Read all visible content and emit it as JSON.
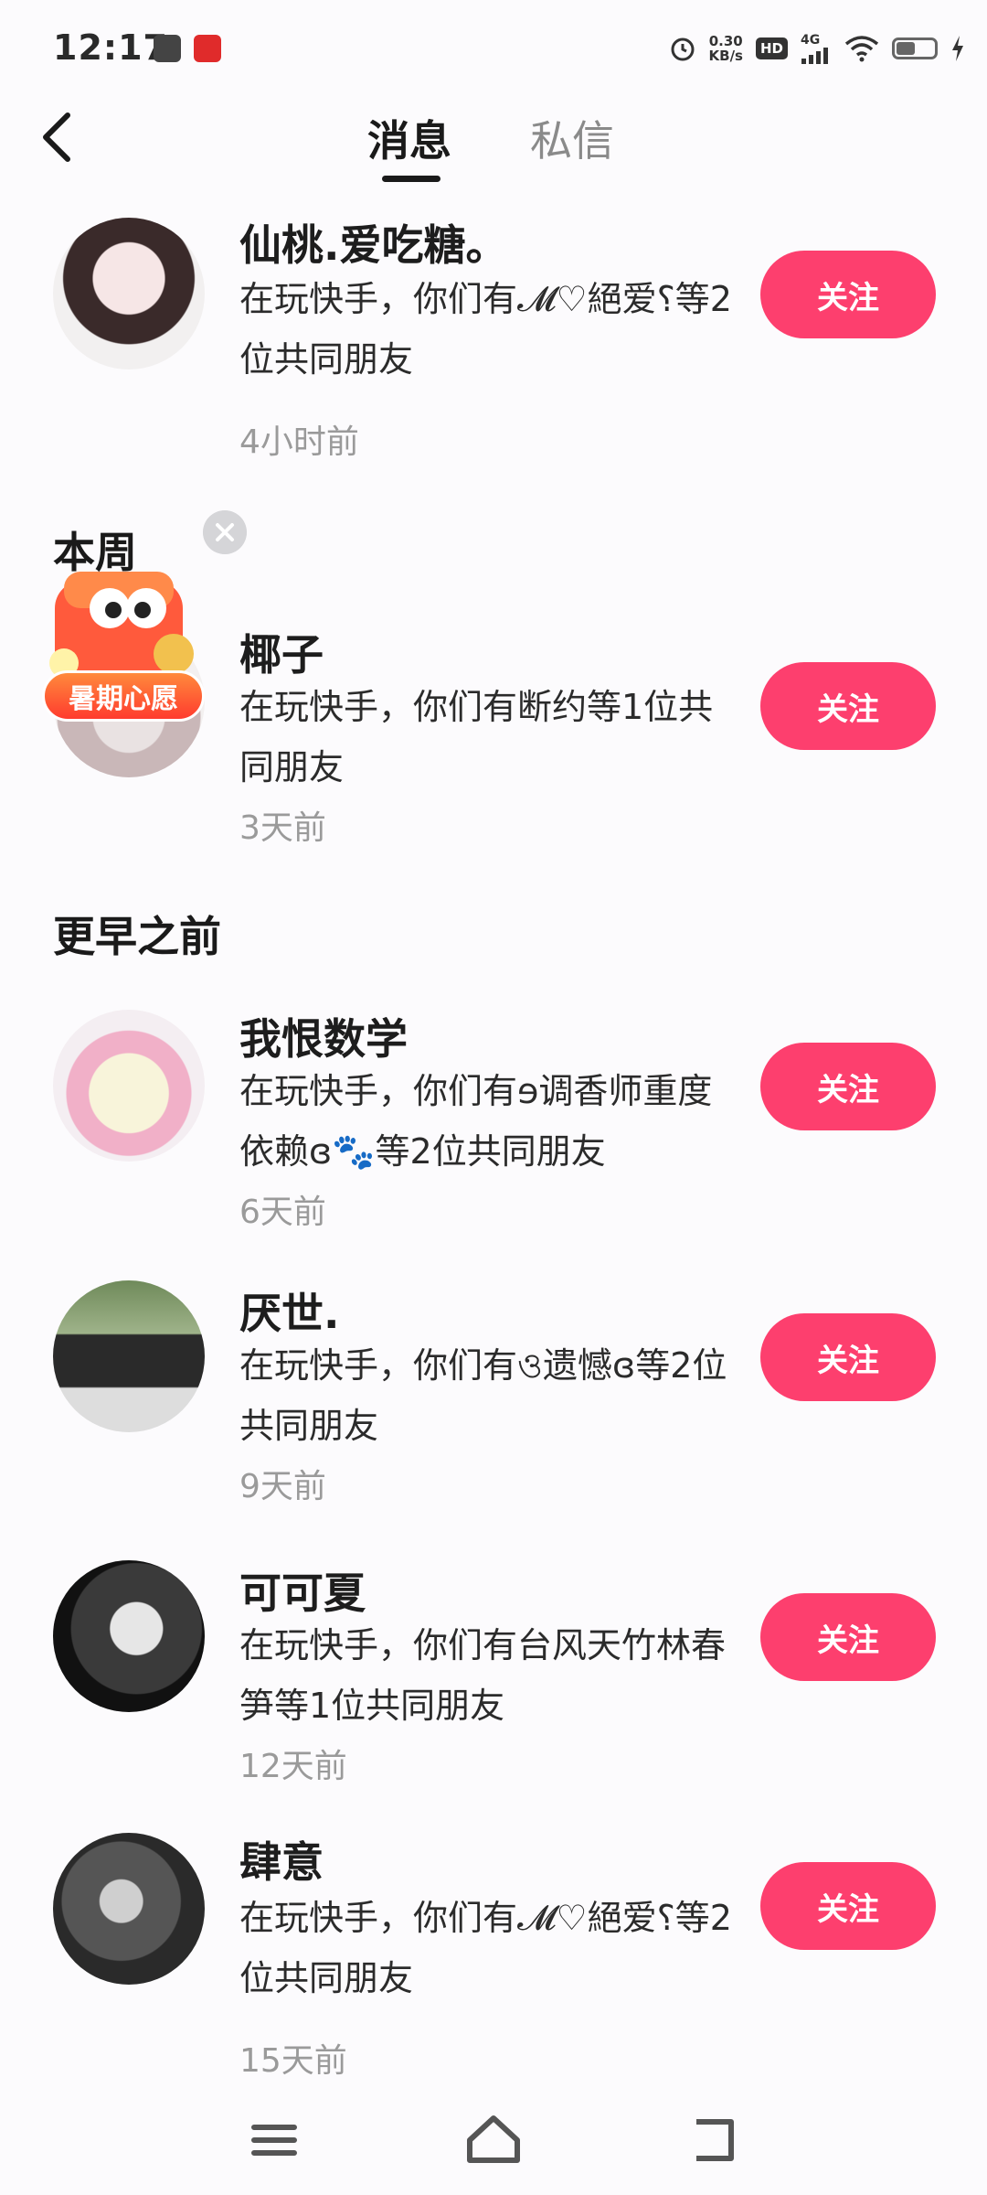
{
  "status_bar": {
    "time": "12:17",
    "net_speed_value": "0.30",
    "net_speed_unit": "KB/s",
    "hd": "HD",
    "signal": "4G",
    "battery_level": 0.45
  },
  "header": {
    "tabs": [
      {
        "label": "消息",
        "active": true
      },
      {
        "label": "私信",
        "active": false
      }
    ]
  },
  "sections": {
    "this_week": "本周",
    "earlier": "更早之前"
  },
  "sticker": {
    "label": "暑期心愿"
  },
  "follow_label": "关注",
  "rows": [
    {
      "name": "仙桃.爱吃糖。",
      "desc": "在玩快手，你们有𝓜♡絕爱⸮等2位共同朋友",
      "time": "4小时前"
    },
    {
      "name": "椰子",
      "desc": "在玩快手，你们有断约等1位共同朋友",
      "time": "3天前"
    },
    {
      "name": "我恨数学",
      "desc": "在玩快手，你们有ɘ调香师重度依赖ɞ🐾等2位共同朋友",
      "time": "6天前"
    },
    {
      "name": "厌世.",
      "desc": "在玩快手，你们有ও遗憾ɞ等2位共同朋友",
      "time": "9天前"
    },
    {
      "name": "可可夏",
      "desc": "在玩快手，你们有台风天竹林春笋等1位共同朋友",
      "time": "12天前"
    },
    {
      "name": "肆意",
      "desc": "在玩快手，你们有𝓜♡絕爱⸮等2位共同朋友",
      "time": "15天前"
    }
  ],
  "colors": {
    "accent": "#fd3f6e",
    "background": "#fcfbfd"
  },
  "icons": {
    "back": "chevron-left-icon",
    "menu": "menu-icon",
    "home": "home-icon",
    "back_nav": "back-nav-icon"
  }
}
